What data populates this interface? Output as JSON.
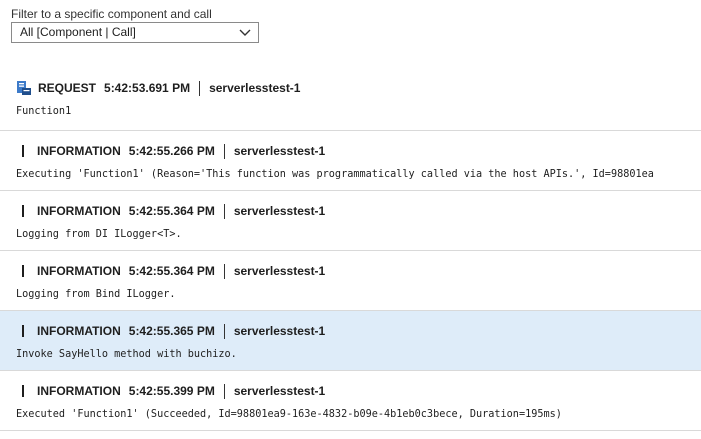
{
  "filter": {
    "label": "Filter to a specific component and call",
    "selected": "All [Component | Call]"
  },
  "entries": [
    {
      "level": "REQUEST",
      "time": "5:42:53.691 PM",
      "source": "serverlesstest-1",
      "message": "Function1"
    },
    {
      "level": "INFORMATION",
      "time": "5:42:55.266 PM",
      "source": "serverlesstest-1",
      "message": "Executing 'Function1' (Reason='This function was programmatically called via the host APIs.', Id=98801ea"
    },
    {
      "level": "INFORMATION",
      "time": "5:42:55.364 PM",
      "source": "serverlesstest-1",
      "message": "Logging from DI ILogger<T>."
    },
    {
      "level": "INFORMATION",
      "time": "5:42:55.364 PM",
      "source": "serverlesstest-1",
      "message": "Logging from Bind ILogger."
    },
    {
      "level": "INFORMATION",
      "time": "5:42:55.365 PM",
      "source": "serverlesstest-1",
      "message": "Invoke SayHello method with buchizo."
    },
    {
      "level": "INFORMATION",
      "time": "5:42:55.399 PM",
      "source": "serverlesstest-1",
      "message": "Executed 'Function1' (Succeeded, Id=98801ea9-163e-4832-b09e-4b1eb0c3bece, Duration=195ms)"
    }
  ],
  "icons": {
    "request": "request-icon",
    "chevron": "chevron-down-icon"
  },
  "colors": {
    "selected_row": "#deecf9",
    "divider": "#d9d9d9",
    "request_icon": "#3c7ac9"
  }
}
